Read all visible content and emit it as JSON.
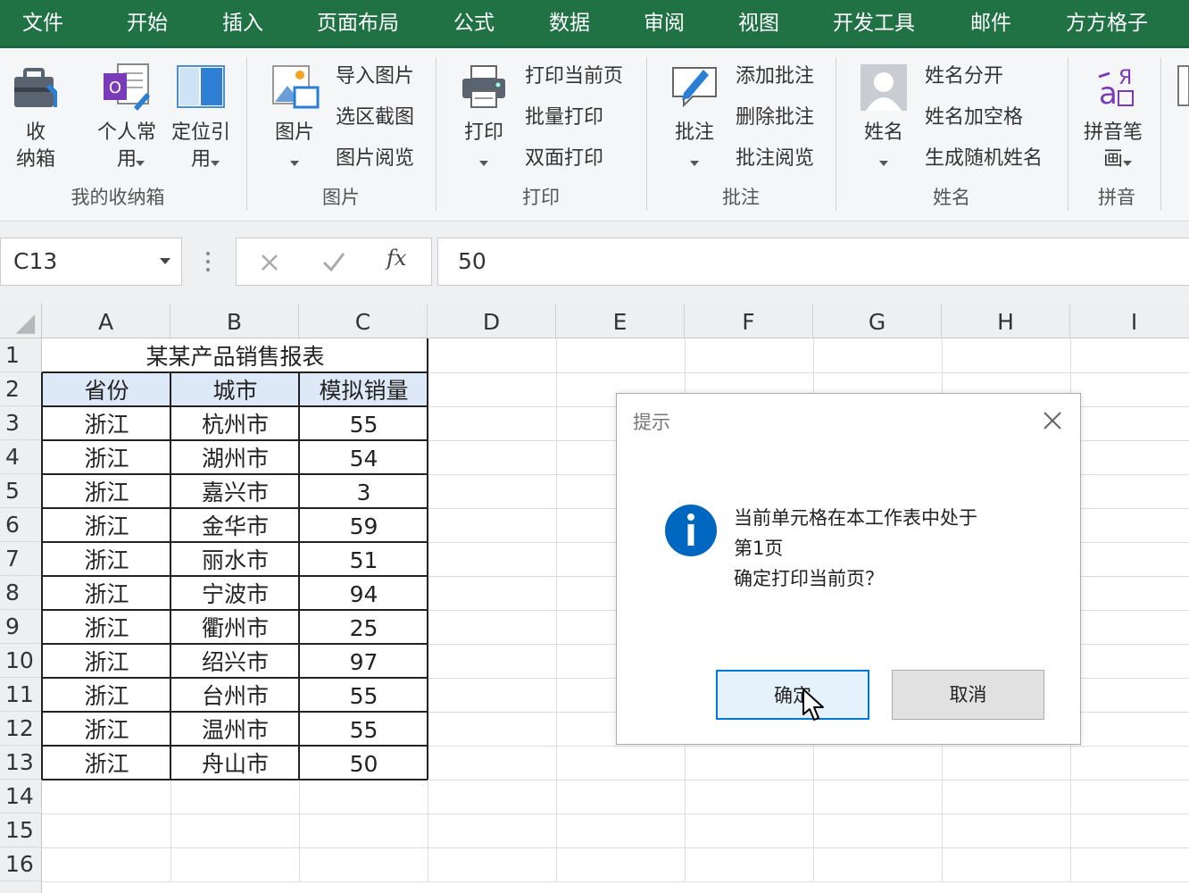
{
  "tabs": [
    "文件",
    "开始",
    "插入",
    "页面布局",
    "公式",
    "数据",
    "审阅",
    "视图",
    "开发工具",
    "邮件",
    "方方格子"
  ],
  "ribbon": {
    "groups": {
      "box": "我的收纳箱",
      "picture": "图片",
      "print": "打印",
      "comment": "批注",
      "name": "姓名",
      "pinyin": "拼音"
    },
    "box_btn": {
      "line1": "收",
      "line2": "纳箱"
    },
    "personal_btn": {
      "line1": "个人常",
      "line2": "用"
    },
    "locate_btn": {
      "line1": "定位引",
      "line2": "用"
    },
    "picture_btn": "图片",
    "picture_items": [
      "导入图片",
      "选区截图",
      "图片阅览"
    ],
    "print_btn": "打印",
    "print_items": [
      "打印当前页",
      "批量打印",
      "双面打印"
    ],
    "comment_btn": "批注",
    "comment_items": [
      "添加批注",
      "删除批注",
      "批注阅览"
    ],
    "name_btn": "姓名",
    "name_items": [
      "姓名分开",
      "姓名加空格",
      "生成随机姓名"
    ],
    "pinyin_btn": {
      "line1": "拼音笔",
      "line2": "画"
    }
  },
  "formula_bar": {
    "name_box": "C13",
    "fx_label": "fx",
    "value": "50"
  },
  "sheet": {
    "columns": [
      "A",
      "B",
      "C",
      "D",
      "E",
      "F",
      "G",
      "H",
      "I"
    ],
    "rows": [
      "1",
      "2",
      "3",
      "4",
      "5",
      "6",
      "7",
      "8",
      "9",
      "10",
      "11",
      "12",
      "13",
      "14",
      "15",
      "16"
    ],
    "title": "某某产品销售报表",
    "headers": [
      "省份",
      "城市",
      "模拟销量"
    ],
    "data": [
      [
        "浙江",
        "杭州市",
        "55"
      ],
      [
        "浙江",
        "湖州市",
        "54"
      ],
      [
        "浙江",
        "嘉兴市",
        "3"
      ],
      [
        "浙江",
        "金华市",
        "59"
      ],
      [
        "浙江",
        "丽水市",
        "51"
      ],
      [
        "浙江",
        "宁波市",
        "94"
      ],
      [
        "浙江",
        "衢州市",
        "25"
      ],
      [
        "浙江",
        "绍兴市",
        "97"
      ],
      [
        "浙江",
        "台州市",
        "55"
      ],
      [
        "浙江",
        "温州市",
        "55"
      ],
      [
        "浙江",
        "舟山市",
        "50"
      ]
    ],
    "header_fill": "#dde9f7"
  },
  "dialog": {
    "title": "提示",
    "message_lines": [
      "当前单元格在本工作表中处于",
      "第1页",
      "确定打印当前页？"
    ],
    "ok": "确定",
    "cancel": "取消"
  },
  "colors": {
    "tab_bar": "#207245",
    "info_icon": "#0067c0"
  }
}
